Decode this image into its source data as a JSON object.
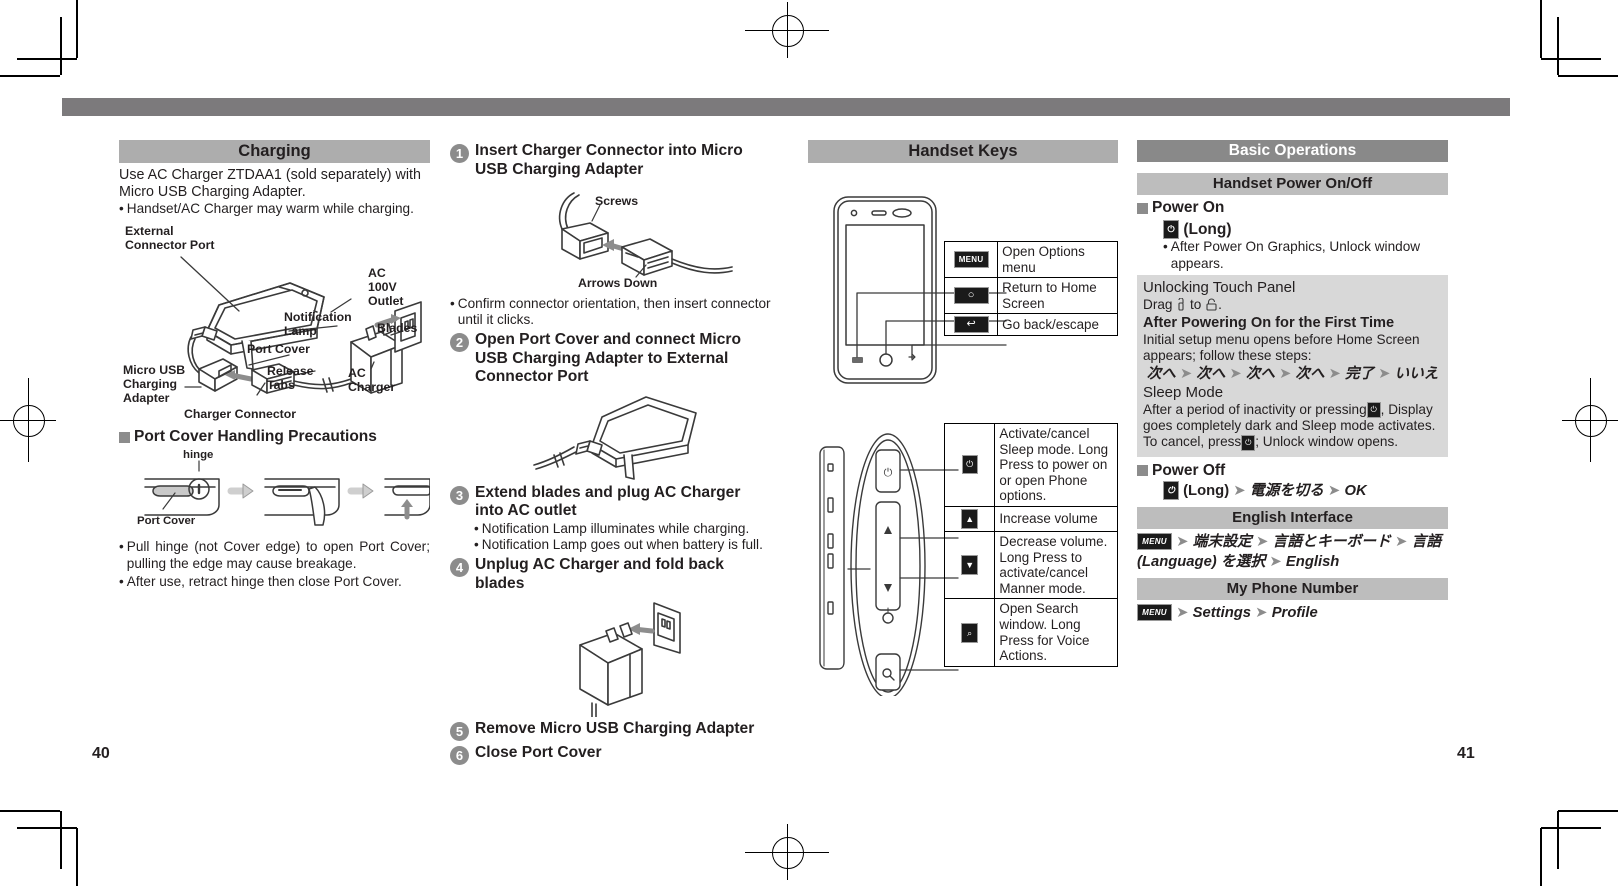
{
  "folio": {
    "left": "40",
    "right": "41"
  },
  "col_charging": {
    "heading": "Charging",
    "intro": "Use AC Charger ZTDAA1 (sold separately) with Micro USB Charging Adapter.",
    "bullet1": "Handset/AC Charger may warm while charging.",
    "labels": {
      "external_connector_port": "External\nConnector Port",
      "ac_outlet": "AC\n100V\nOutlet",
      "notification_lamp": "Notification\nLamp",
      "port_cover": "Port Cover",
      "blades": "Blades",
      "micro_usb_adapter": "Micro USB\nCharging\nAdapter",
      "release_tabs": "Release\nTabs",
      "ac_charger": "AC\nCharger",
      "charger_connector": "Charger Connector"
    },
    "precautions_heading": "Port Cover Handling Precautions",
    "hinge_label": "hinge",
    "port_cover_label": "Port Cover",
    "precaution1": "Pull hinge (not Cover edge) to open Port Cover; pulling the edge may cause breakage.",
    "precaution2": "After use, retract hinge then close Port Cover."
  },
  "col_steps": {
    "step1": {
      "num": "1",
      "text": "Insert Charger Connector into Micro USB Charging Adapter"
    },
    "step1_labels": {
      "screws": "Screws",
      "arrows_down": "Arrows Down"
    },
    "step1_bullet": "Confirm connector orientation, then insert connector until it clicks.",
    "step2": {
      "num": "2",
      "text": "Open Port Cover and connect Micro USB Charging Adapter to External Connector Port"
    },
    "step3": {
      "num": "3",
      "text": "Extend blades and plug AC Charger into AC outlet"
    },
    "step3_bullet1": "Notification Lamp illuminates while charging.",
    "step3_bullet2": "Notification Lamp goes out when battery is full.",
    "step4": {
      "num": "4",
      "text": "Unplug AC Charger and fold back blades"
    },
    "step5": {
      "num": "5",
      "text": "Remove Micro USB Charging Adapter"
    },
    "step6": {
      "num": "6",
      "text": "Close Port Cover"
    }
  },
  "col_keys": {
    "heading": "Handset Keys",
    "front_table": [
      {
        "key": "MENU",
        "icon": "menu-key-icon",
        "desc": "Open Options menu"
      },
      {
        "key": "○",
        "icon": "home-key-icon",
        "desc": "Return to Home Screen"
      },
      {
        "key": "↩",
        "icon": "back-key-icon",
        "desc": "Go back/escape"
      }
    ],
    "side_table": [
      {
        "key": "⏻",
        "icon": "power-key-icon",
        "desc": "Activate/cancel Sleep mode. Long Press to power on or open Phone options."
      },
      {
        "key": "▲",
        "icon": "volume-up-key-icon",
        "desc": "Increase volume"
      },
      {
        "key": "▼",
        "icon": "volume-down-key-icon",
        "desc": "Decrease volume. Long Press to activate/cancel Manner mode."
      },
      {
        "key": "⌕",
        "icon": "search-key-icon",
        "desc": "Open Search window. Long Press for Voice Actions."
      }
    ]
  },
  "col_basic": {
    "heading": "Basic Operations",
    "power_section": "Handset Power On/Off",
    "power_on_heading": "Power On",
    "power_on_key": "⏻",
    "power_on_long": "(Long)",
    "power_on_bullet": "After Power On Graphics, Unlock window appears.",
    "unlock_title": "Unlocking Touch Panel",
    "unlock_text_pre": "Drag",
    "unlock_text_mid": "to",
    "unlock_text_post": ".",
    "first_time_title": "After Powering On for the First Time",
    "first_time_text": "Initial setup menu opens before Home Screen appears; follow these steps:",
    "first_time_steps": [
      "次へ",
      "次へ",
      "次へ",
      "次へ",
      "完了",
      "いいえ"
    ],
    "sleep_title": "Sleep Mode",
    "sleep_text_1": "After a period of inactivity or pressing",
    "sleep_text_2": ", Display goes completely dark and Sleep mode activates. To cancel, press",
    "sleep_text_3": "; Unlock window opens.",
    "power_off_heading": "Power Off",
    "power_off_long": "(Long)",
    "power_off_step1": "電源を切る",
    "power_off_step2": "OK",
    "english_heading": "English Interface",
    "english_menu_chip": "MENU",
    "english_step1": "端末設定",
    "english_step2": "言語とキーボード",
    "english_step3": "言語 (Language) を選択",
    "english_step4": "English",
    "phone_heading": "My Phone Number",
    "phone_menu_chip": "MENU",
    "phone_step1": "Settings",
    "phone_step2": "Profile"
  },
  "colors": {
    "band_light": "#adadad",
    "band_dark": "#898989",
    "band_mid": "#bdbdbd",
    "topbar": "#7c7a7c",
    "infobox": "#d8d8d8",
    "ink": "#231f20"
  }
}
